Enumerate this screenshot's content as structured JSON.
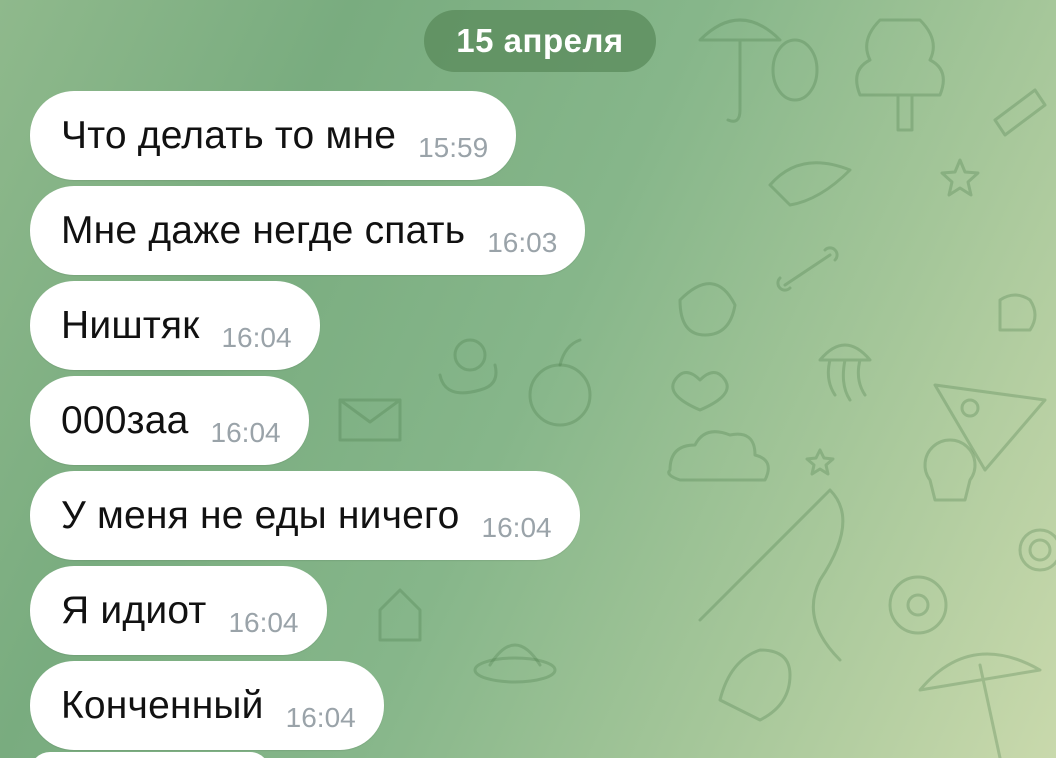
{
  "chat": {
    "date_label": "15 апреля",
    "messages": [
      {
        "text": "Что делать то мне",
        "time": "15:59"
      },
      {
        "text": "Мне даже негде спать",
        "time": "16:03"
      },
      {
        "text": "Ништяк",
        "time": "16:04"
      },
      {
        "text": "000заа",
        "time": "16:04"
      },
      {
        "text": "У меня не еды ничего",
        "time": "16:04"
      },
      {
        "text": "Я идиот",
        "time": "16:04"
      },
      {
        "text": "Конченный",
        "time": "16:04"
      }
    ]
  },
  "colors": {
    "bubble": "#ffffff",
    "date_pill": "#5b8c5c",
    "timestamp": "#9aa3a9",
    "wallpaper_dark": "#79ac7f",
    "wallpaper_light": "#c9d9ac"
  },
  "icons": [
    "doodle-wallpaper"
  ]
}
